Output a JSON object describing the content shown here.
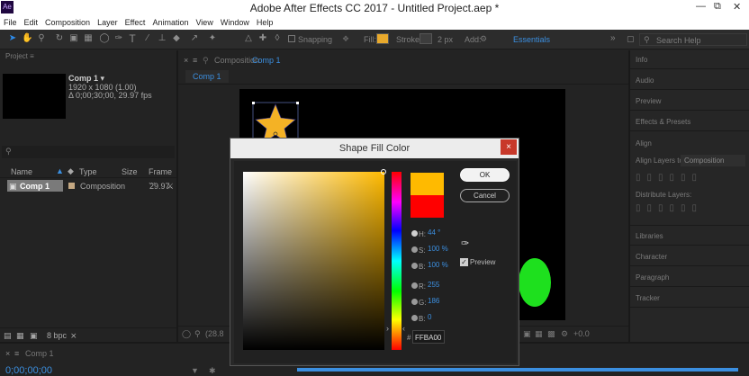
{
  "title_bar": {
    "app_icon_text": "Ae",
    "title": "Adobe After Effects CC 2017 - Untitled Project.aep *"
  },
  "menu": [
    "File",
    "Edit",
    "Composition",
    "Layer",
    "Effect",
    "Animation",
    "View",
    "Window",
    "Help"
  ],
  "toolbar": {
    "snapping": "Snapping",
    "fill_label": "Fill:",
    "stroke_label": "Stroke:",
    "stroke_width": "2 px",
    "add_label": "Add:",
    "workspace": "Essentials",
    "search_placeholder": "Search Help"
  },
  "project": {
    "panel_title": "Project",
    "comp_name": "Comp 1 ▾",
    "comp_size": "1920 x 1080 (1.00)",
    "comp_duration": "Δ 0;00;30;00, 29.97 fps",
    "columns": [
      "Name",
      "Type",
      "Size",
      "Frame ..."
    ],
    "row": {
      "name": "Comp 1",
      "type": "Composition",
      "frame": "29.97"
    },
    "bpc": "8 bpc"
  },
  "composition": {
    "panel_label": "Composition",
    "comp_link": "Comp 1",
    "tab": "Comp 1",
    "zoom": "(28.8",
    "offset": "+0.0"
  },
  "right_panels": {
    "info": "Info",
    "audio": "Audio",
    "preview": "Preview",
    "effects": "Effects & Presets",
    "align": "Align",
    "align_to_label": "Align Layers to:",
    "align_to_value": "Composition",
    "distribute": "Distribute Layers:",
    "libraries": "Libraries",
    "character": "Character",
    "paragraph": "Paragraph",
    "tracker": "Tracker"
  },
  "timeline": {
    "tab": "Comp 1",
    "timecode": "0;00;00;00"
  },
  "dialog": {
    "title": "Shape Fill Color",
    "close": "×",
    "ok": "OK",
    "cancel": "Cancel",
    "preview_label": "Preview",
    "h_label": "H:",
    "h_value": "44 °",
    "s_label": "S:",
    "s_value": "100 %",
    "b_label": "B:",
    "b_value": "100 %",
    "r_label": "R:",
    "r_value": "255",
    "g_label": "G:",
    "g_value": "186",
    "bl_label": "B:",
    "bl_value": "0",
    "hash": "#",
    "hex": "FFBA00",
    "new_color": "#ffba00",
    "old_color": "#ff0000"
  },
  "colors": {
    "accent": "#3b8fe0",
    "fill": "#e8a92c",
    "star": "#f4b225",
    "circle": "#1ee01e"
  }
}
